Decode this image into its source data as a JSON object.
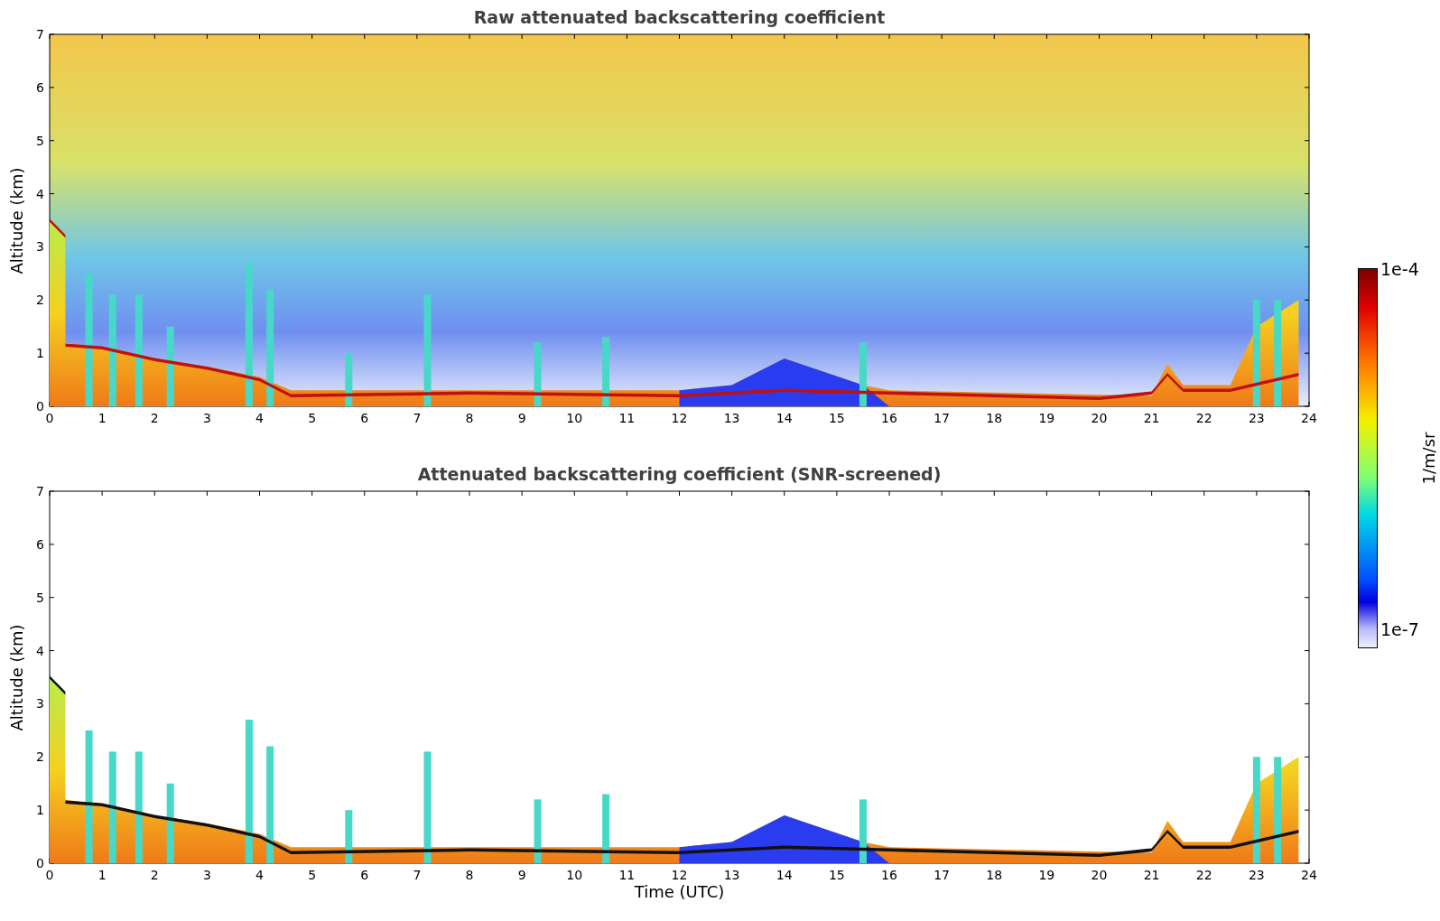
{
  "panels": [
    {
      "title": "Raw attenuated backscattering coefficient",
      "ylabel": "Altitude (km)",
      "screened": false,
      "yticks": [
        "7",
        "6",
        "5",
        "4",
        "3",
        "2",
        "1",
        "0"
      ],
      "xticks": [
        "0",
        "1",
        "2",
        "3",
        "4",
        "5",
        "6",
        "7",
        "8",
        "9",
        "10",
        "11",
        "12",
        "13",
        "14",
        "15",
        "16",
        "17",
        "18",
        "19",
        "20",
        "21",
        "22",
        "23",
        "24"
      ]
    },
    {
      "title": "Attenuated backscattering coefficient (SNR-screened)",
      "ylabel": "Altitude (km)",
      "screened": true,
      "yticks": [
        "7",
        "6",
        "5",
        "4",
        "3",
        "2",
        "1",
        "0"
      ],
      "xticks": [
        "0",
        "1",
        "2",
        "3",
        "4",
        "5",
        "6",
        "7",
        "8",
        "9",
        "10",
        "11",
        "12",
        "13",
        "14",
        "15",
        "16",
        "17",
        "18",
        "19",
        "20",
        "21",
        "22",
        "23",
        "24"
      ],
      "xlabel": "Time (UTC)"
    }
  ],
  "colorbar": {
    "max_label": "1e-4",
    "min_label": "1e-7",
    "unit": "1/m/sr"
  }
}
